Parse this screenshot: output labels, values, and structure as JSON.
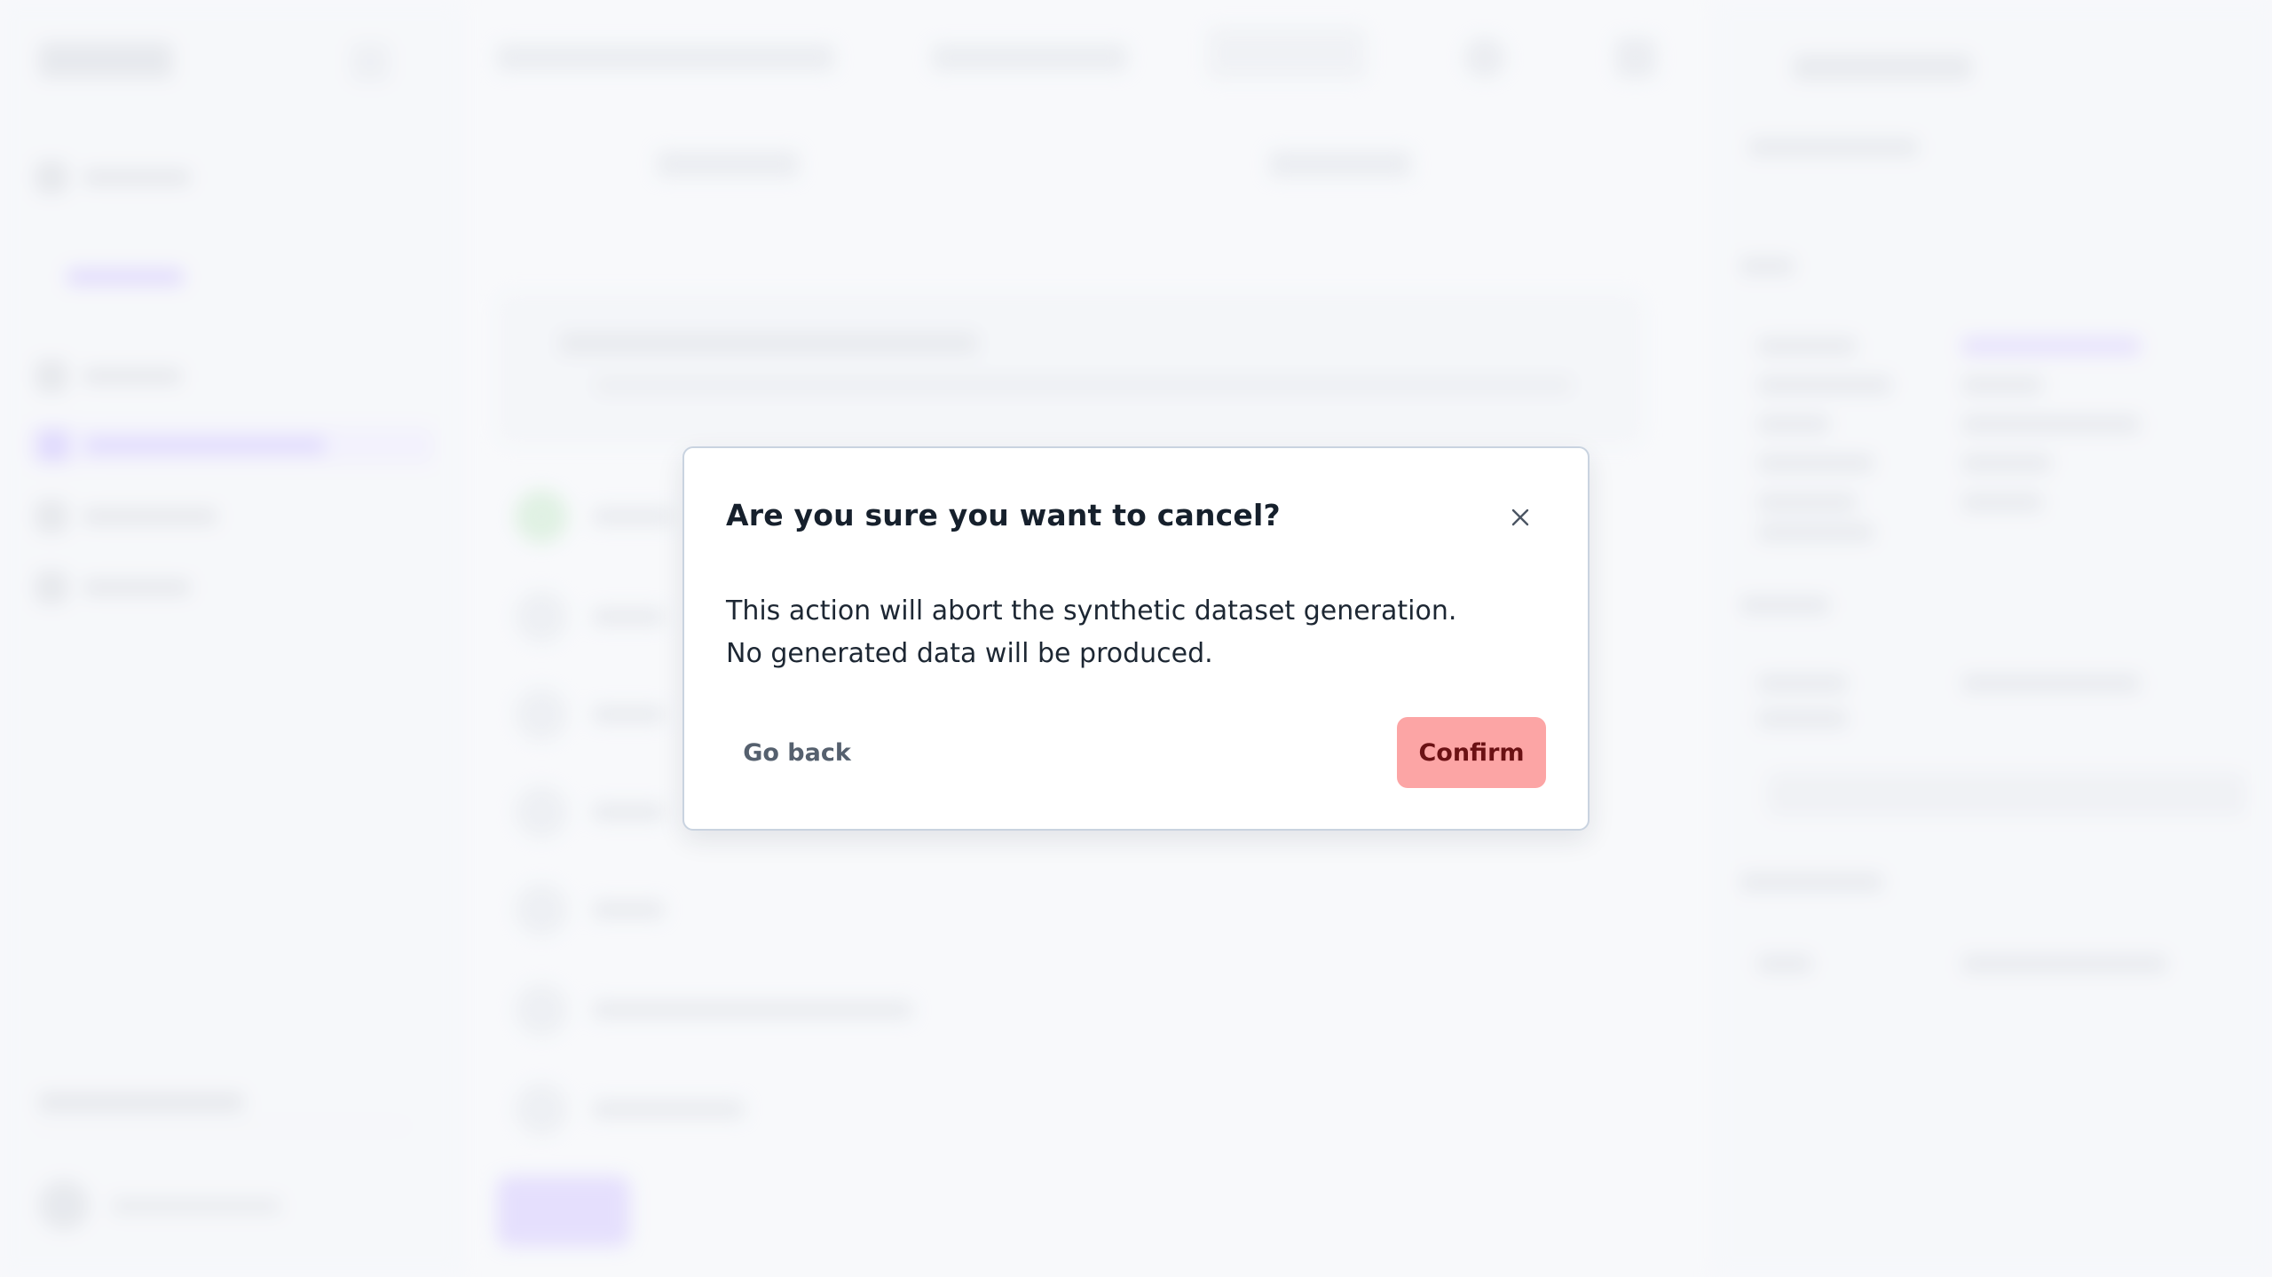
{
  "dialog": {
    "title": "Are you sure you want to cancel?",
    "body": "This action will abort the synthetic dataset generation. No generated data will be produced.",
    "go_back_label": "Go back",
    "confirm_label": "Confirm",
    "close_icon": "close-icon"
  },
  "colors": {
    "confirm_bg": "#fca5a5",
    "confirm_text": "#6b1114",
    "accent_purple": "#c4b3ff",
    "page_bg": "#f7f9fb"
  }
}
